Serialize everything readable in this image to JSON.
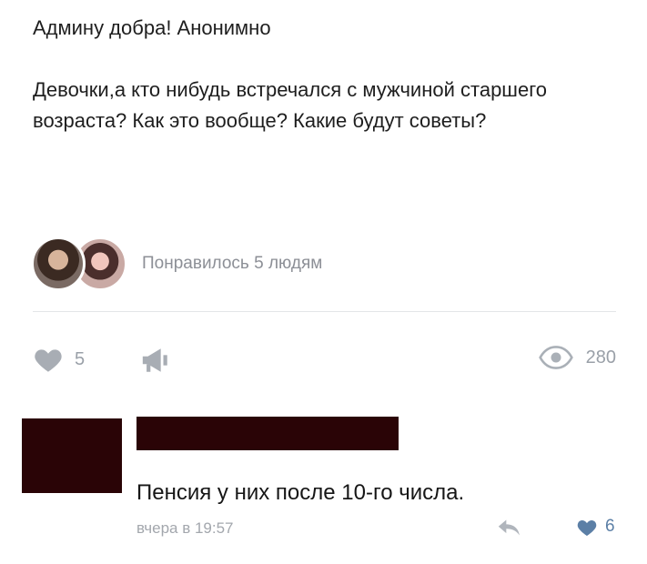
{
  "post": {
    "line1": "Админу добра! Анонимно",
    "body": "Девочки,а кто нибудь встречался с мужчиной старшего возраста? Как это вообще? Какие будут советы?"
  },
  "likers": {
    "text": "Понравилось 5 людям"
  },
  "actions": {
    "like_count": "5",
    "views_count": "280"
  },
  "comment": {
    "text": "Пенсия у них после 10-го числа.",
    "time": "вчера в 19:57",
    "like_count": "6"
  },
  "colors": {
    "redaction": "#2a0406",
    "muted": "#9aa0a8",
    "liked_blue": "#5b7fa6"
  }
}
